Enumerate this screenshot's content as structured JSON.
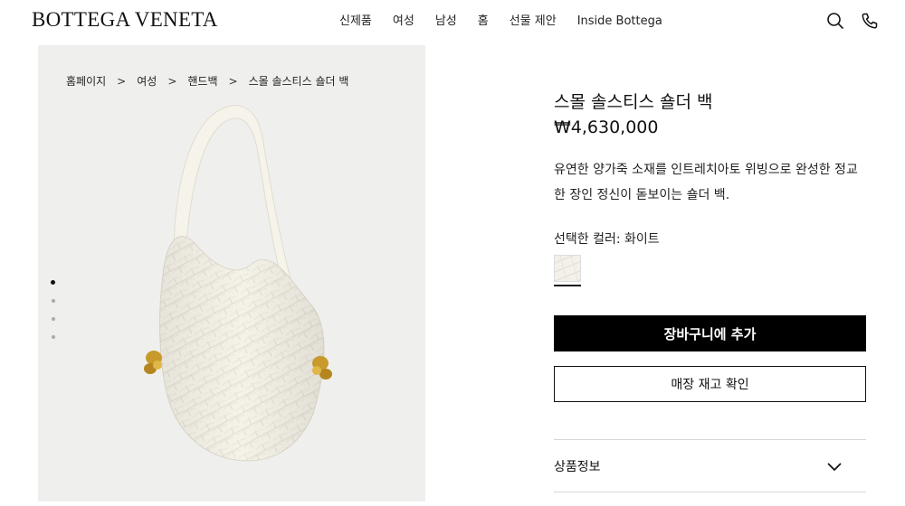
{
  "header": {
    "logo": "BOTTEGA VENETA",
    "nav": [
      "신제품",
      "여성",
      "남성",
      "홈",
      "선물 제안",
      "Inside Bottega"
    ],
    "icons": [
      "search-icon",
      "phone-icon"
    ]
  },
  "breadcrumb": [
    "홈페이지",
    "여성",
    "핸드백",
    "스몰 솔스티스 숄더 백"
  ],
  "breadcrumb_separator": ">",
  "gallery": {
    "slide_count": 4,
    "active_slide": 1,
    "image": "white intrecciato leather hobo shoulder bag with gold knot hardware"
  },
  "product": {
    "title": "스몰 솔스티스 숄더 백",
    "price": "₩4,630,000",
    "description": "유연한 양가죽 소재를 인트레치아토 위빙으로 완성한 정교한 장인 정신이 돋보이는 숄더 백.",
    "color_label": "선택한 컬러: 화이트",
    "swatch_color": "#f3f1ea",
    "add_to_cart": "장바구니에 추가",
    "check_stock": "매장 재고 확인",
    "accordion_label": "상품정보"
  },
  "colors": {
    "gallery_bg": "#eff0ee",
    "bag": "#f6f3ea",
    "hardware": "#c89a2c",
    "button": "#000000"
  }
}
